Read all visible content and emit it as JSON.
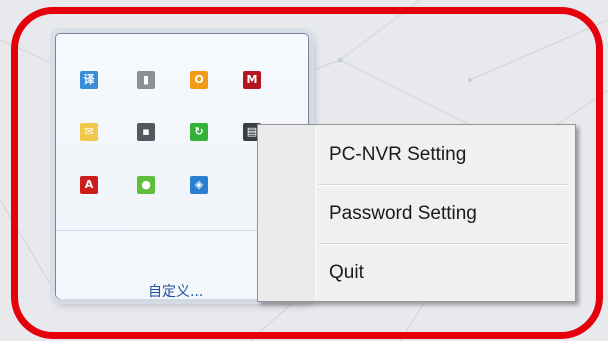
{
  "tray": {
    "icons": [
      {
        "name": "translate-app-icon",
        "glyph": "译",
        "color": "#3a8bd8"
      },
      {
        "name": "battery-check-icon",
        "glyph": "▮",
        "color": "#8a8f98"
      },
      {
        "name": "outlook-icon",
        "glyph": "O",
        "color": "#f29a1a"
      },
      {
        "name": "mcafee-shield-icon",
        "glyph": "M",
        "color": "#b5161d"
      },
      {
        "name": "mail-envelope-icon",
        "glyph": "✉",
        "color": "#f0c94a"
      },
      {
        "name": "usb-device-icon",
        "glyph": "▪",
        "color": "#505860"
      },
      {
        "name": "sync-arrows-icon",
        "glyph": "↻",
        "color": "#35b23a"
      },
      {
        "name": "nvr-app-icon",
        "glyph": "▤",
        "color": "#3b3f45"
      },
      {
        "name": "adobe-icon",
        "glyph": "A",
        "color": "#cc1d1d"
      },
      {
        "name": "wechat-icon",
        "glyph": "●",
        "color": "#5fbf3b"
      },
      {
        "name": "box-app-icon",
        "glyph": "◈",
        "color": "#2b7fd3"
      }
    ],
    "customize_label": "自定义..."
  },
  "context_menu": {
    "items": [
      {
        "label": "PC-NVR Setting"
      },
      {
        "label": "Password Setting"
      },
      {
        "label": "Quit"
      }
    ]
  },
  "colors": {
    "highlight_frame": "#e5000b",
    "menu_background": "#f0f0f0",
    "link": "#1f4f9e"
  }
}
